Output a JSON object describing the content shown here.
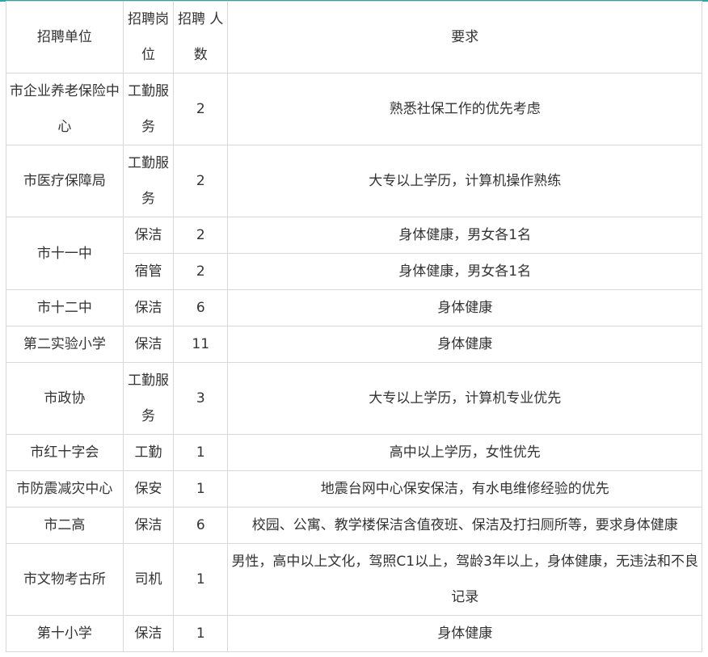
{
  "table": {
    "headers": [
      "招聘单位",
      "招聘岗位",
      "招聘 人数",
      "要求"
    ],
    "rows": [
      {
        "unit": "市企业养老保险中心",
        "post": "工勤服务",
        "count": "2",
        "req": "熟悉社保工作的优先考虑"
      },
      {
        "unit": "市医疗保障局",
        "post": "工勤服务",
        "count": "2",
        "req": "大专以上学历，计算机操作熟练"
      },
      {
        "unit": "市十一中",
        "post": "保洁",
        "count": "2",
        "req": "身体健康，男女各1名"
      },
      {
        "unit": "",
        "post": "宿管",
        "count": "2",
        "req": "身体健康，男女各1名"
      },
      {
        "unit": "市十二中",
        "post": "保洁",
        "count": "6",
        "req": "身体健康"
      },
      {
        "unit": "第二实验小学",
        "post": "保洁",
        "count": "11",
        "req": "身体健康"
      },
      {
        "unit": "市政协",
        "post": "工勤服务",
        "count": "3",
        "req": "大专以上学历，计算机专业优先"
      },
      {
        "unit": "市红十字会",
        "post": "工勤",
        "count": "1",
        "req": "高中以上学历，女性优先"
      },
      {
        "unit": "市防震减灾中心",
        "post": "保安",
        "count": "1",
        "req": "地震台网中心保安保洁，有水电维修经验的优先"
      },
      {
        "unit": "市二高",
        "post": "保洁",
        "count": "6",
        "req": "校园、公寓、教学楼保洁含值夜班、保洁及打扫厕所等，要求身体健康"
      },
      {
        "unit": "市文物考古所",
        "post": "司机",
        "count": "1",
        "req": "男性，高中以上文化，驾照C1以上，驾龄3年以上，身体健康，无违法和不良记录"
      },
      {
        "unit": "第十小学",
        "post": "保洁",
        "count": "1",
        "req": "身体健康"
      }
    ]
  }
}
